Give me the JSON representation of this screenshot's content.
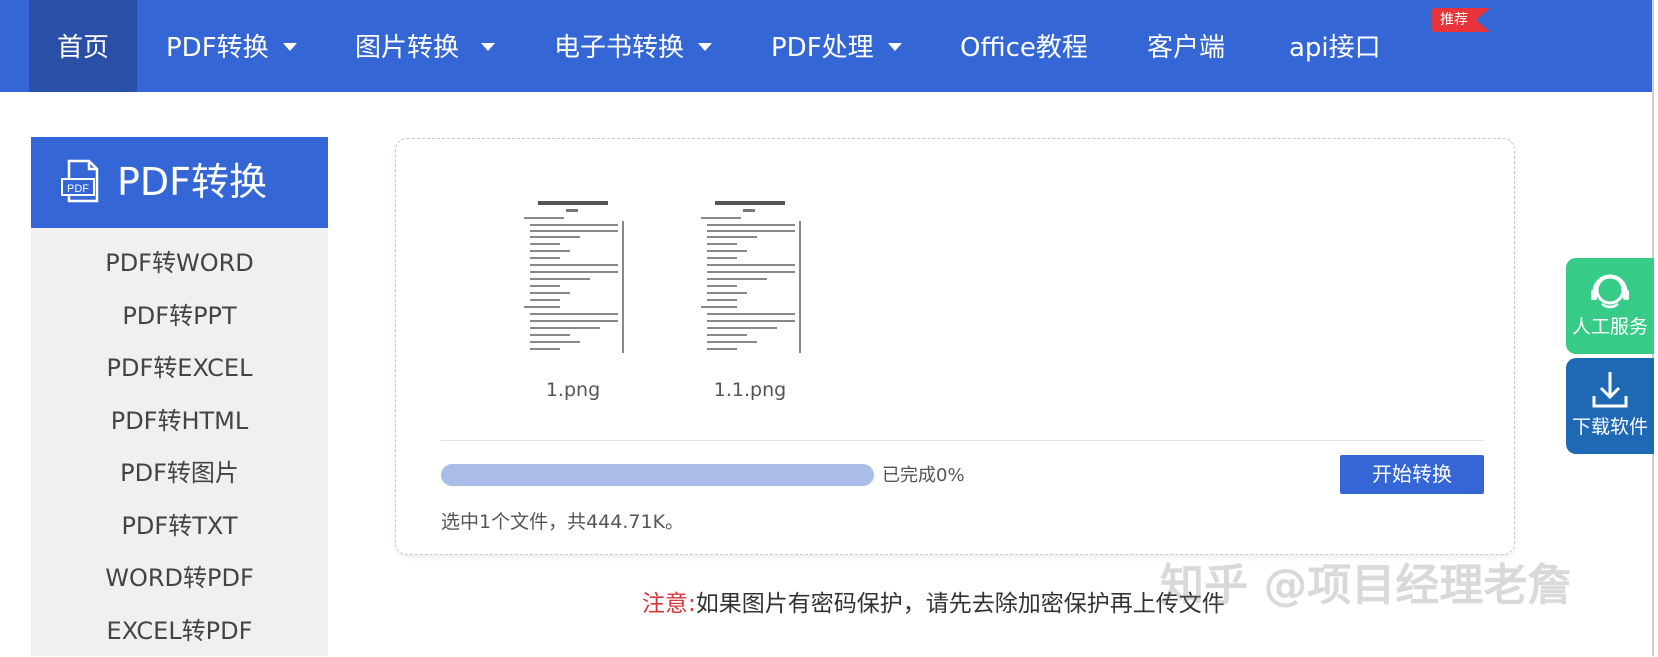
{
  "nav": {
    "items": [
      {
        "label": "首页",
        "active": true,
        "dropdown": false
      },
      {
        "label": "PDF转换",
        "active": false,
        "dropdown": true
      },
      {
        "label": "图片转换",
        "active": false,
        "dropdown": true
      },
      {
        "label": "电子书转换",
        "active": false,
        "dropdown": true
      },
      {
        "label": "PDF处理",
        "active": false,
        "dropdown": true
      },
      {
        "label": "Office教程",
        "active": false,
        "dropdown": false
      },
      {
        "label": "客户端",
        "active": false,
        "dropdown": false
      },
      {
        "label": "api接口",
        "active": false,
        "dropdown": false
      }
    ],
    "badge": "推荐"
  },
  "sidebar": {
    "title": "PDF转换",
    "icon": "pdf-file-icon",
    "items": [
      "PDF转WORD",
      "PDF转PPT",
      "PDF转EXCEL",
      "PDF转HTML",
      "PDF转图片",
      "PDF转TXT",
      "WORD转PDF",
      "EXCEL转PDF"
    ]
  },
  "upload": {
    "files": [
      {
        "name": "1.png"
      },
      {
        "name": "1.1.png"
      }
    ],
    "progress_fraction": 0.0,
    "progress_text": "已完成0%",
    "start_button": "开始转换",
    "selected_text": "选中1个文件，共444.71K。"
  },
  "notice": {
    "label": "注意:",
    "text": "如果图片有密码保护，请先去除加密保护再上传文件"
  },
  "watermark": "知乎 @项目经理老詹",
  "float": {
    "service_label": "人工服务",
    "download_label": "下载软件",
    "service_icon": "headset-icon",
    "download_icon": "download-icon"
  },
  "colors": {
    "primary": "#3466d6",
    "active_nav": "#2a4fa6",
    "badge": "#e8333a",
    "service": "#36cc87",
    "download": "#1f68b3",
    "notice_label": "#d9363e",
    "progress_track": "#a9bde6"
  }
}
